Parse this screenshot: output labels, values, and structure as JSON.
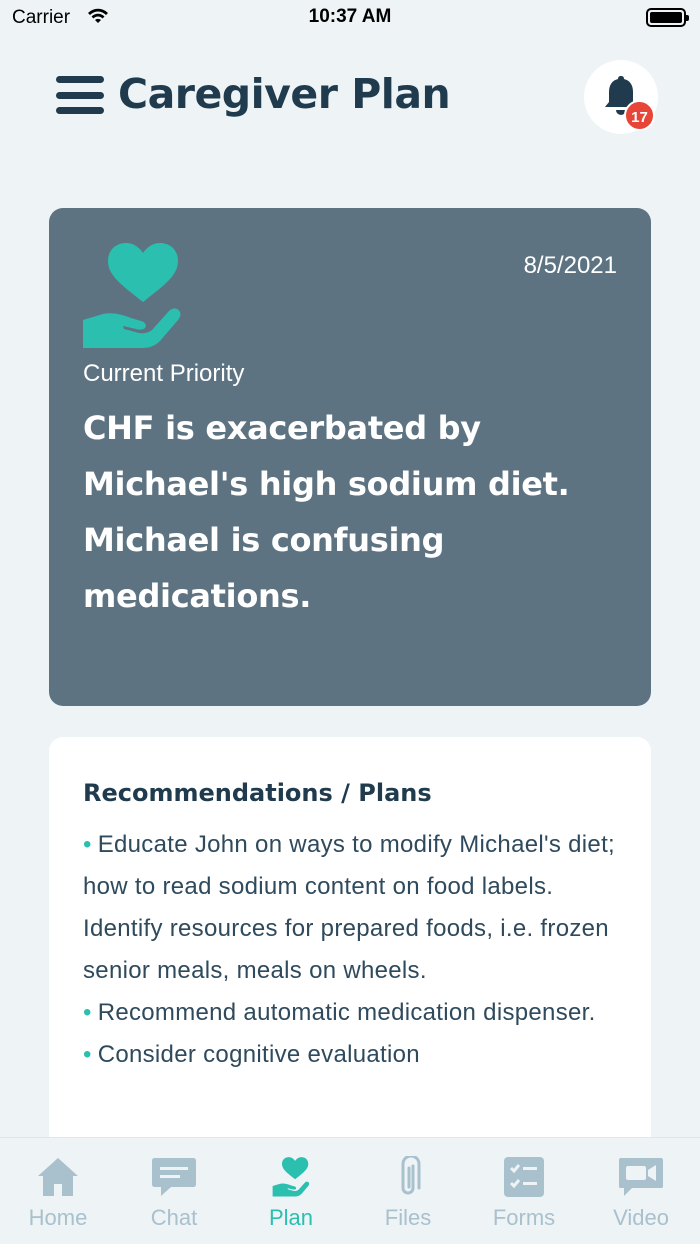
{
  "status_bar": {
    "carrier": "Carrier",
    "time": "10:37 AM"
  },
  "header": {
    "title": "Caregiver Plan",
    "notification_count": "17"
  },
  "priority": {
    "date": "8/5/2021",
    "label": "Current Priority",
    "text": "CHF is exacerbated by Michael's high sodium diet. Michael is confusing medications."
  },
  "plan": {
    "title": "Recommendations / Plans",
    "items": [
      "Educate John on ways to modify Michael's diet; how to read sodium content on food labels.  Identify resources for prepared foods, i.e. frozen senior meals, meals on wheels.",
      "Recommend automatic medication dispenser.",
      "Consider cognitive evaluation"
    ]
  },
  "tabs": [
    {
      "label": "Home",
      "icon": "home-icon"
    },
    {
      "label": "Chat",
      "icon": "chat-icon"
    },
    {
      "label": "Plan",
      "icon": "heart-hand-icon",
      "active": true
    },
    {
      "label": "Files",
      "icon": "paperclip-icon"
    },
    {
      "label": "Forms",
      "icon": "checklist-icon"
    },
    {
      "label": "Video",
      "icon": "video-camera-icon"
    }
  ],
  "colors": {
    "accent": "#2bbfb0",
    "card": "#5e7382",
    "text_dark": "#1f3b4d",
    "badge": "#e74538",
    "tab_inactive": "#a9c0cd"
  }
}
